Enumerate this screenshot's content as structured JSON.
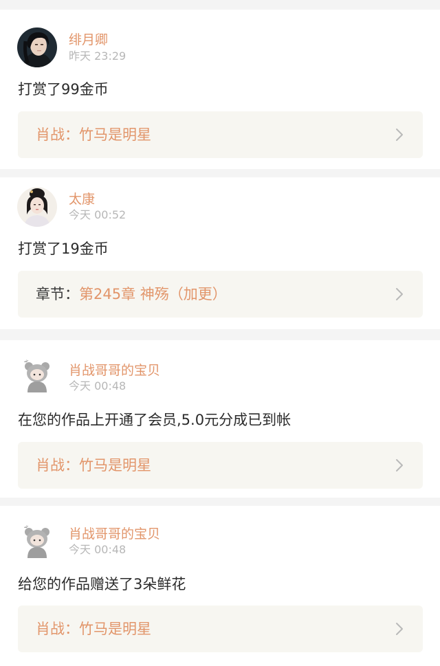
{
  "feed": {
    "items": [
      {
        "avatar_icon": "avatar-young-man-icon",
        "name": "绯月卿",
        "time": "昨天 23:29",
        "message": "打赏了99金币",
        "link": {
          "prefix": "肖战：",
          "title": "竹马是明星",
          "chevron_icon": "chevron-right-icon"
        }
      },
      {
        "avatar_icon": "avatar-ancient-lady-icon",
        "name": "太康",
        "time": "今天 00:52",
        "message": "打赏了19金币",
        "link": {
          "prefix": "章节：",
          "title": "第245章 神殇（加更）",
          "chevron_icon": "chevron-right-icon"
        }
      },
      {
        "avatar_icon": "avatar-bear-hood-chibi-icon",
        "name": "肖战哥哥的宝贝",
        "time": "今天 00:48",
        "message": "在您的作品上开通了会员,5.0元分成已到帐",
        "link": {
          "prefix": "肖战：",
          "title": "竹马是明星",
          "chevron_icon": "chevron-right-icon"
        }
      },
      {
        "avatar_icon": "avatar-bear-hood-chibi-icon",
        "name": "肖战哥哥的宝贝",
        "time": "今天 00:48",
        "message": "给您的作品赠送了3朵鲜花",
        "link": {
          "prefix": "肖战：",
          "title": "竹马是明星",
          "chevron_icon": "chevron-right-icon"
        }
      }
    ]
  },
  "colors": {
    "accent": "#e2956a",
    "time": "#b7b7b7",
    "text": "#2b2b2b",
    "link_bg": "#f7f6f1",
    "separator": "#f4f4f4"
  }
}
